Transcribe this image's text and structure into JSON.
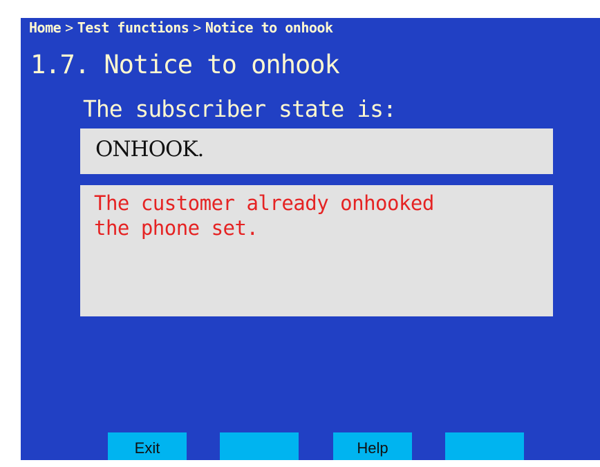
{
  "breadcrumb": {
    "items": [
      "Home",
      "Test functions",
      "Notice to onhook"
    ],
    "separator": ">"
  },
  "page": {
    "title": "1.7. Notice to onhook"
  },
  "prompt": {
    "label": "The subscriber state is:"
  },
  "state": {
    "value": "ONHOOK."
  },
  "message": {
    "lines": [
      "The customer already onhooked",
      "the phone set."
    ]
  },
  "softkeys": [
    {
      "label": "Exit"
    },
    {
      "label": ""
    },
    {
      "label": "Help"
    },
    {
      "label": ""
    }
  ],
  "colors": {
    "background": "#2140c4",
    "text": "#fff8d0",
    "panel": "#e2e2e2",
    "message": "#e52323",
    "softkey": "#00b4f0"
  }
}
